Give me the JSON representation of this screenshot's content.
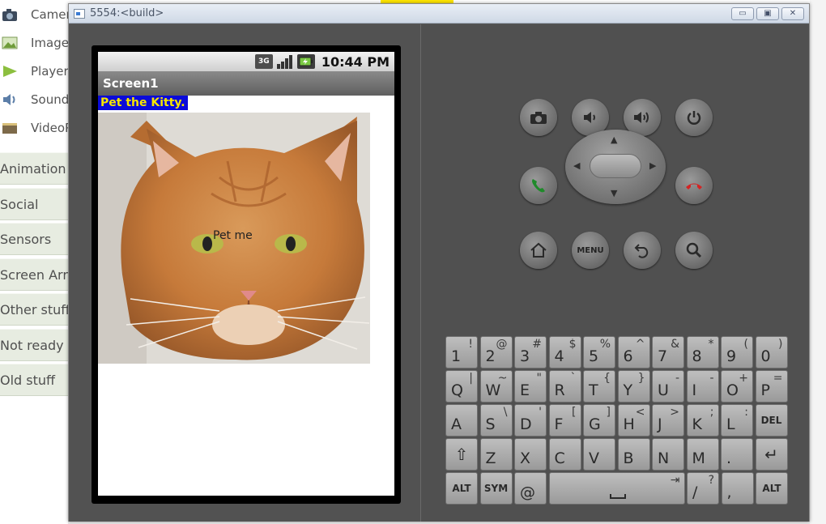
{
  "palette": {
    "items": [
      {
        "label": "Camera",
        "icon": "camera-icon"
      },
      {
        "label": "ImagePicker",
        "icon": "image-picker-icon"
      },
      {
        "label": "Player",
        "icon": "player-icon"
      },
      {
        "label": "Sound",
        "icon": "sound-icon"
      },
      {
        "label": "VideoPlayer",
        "icon": "video-icon"
      }
    ],
    "categories": [
      "Animation",
      "Social",
      "Sensors",
      "Screen Arrangement",
      "Other stuff",
      "Not ready for prime time",
      "Old stuff"
    ]
  },
  "window": {
    "title": "5554:<build>",
    "minimize": "▭",
    "maximize": "▣",
    "close": "✕"
  },
  "phone": {
    "status": {
      "network": "3G",
      "time": "10:44 PM"
    },
    "appbar_title": "Screen1",
    "label_text": "Pet the Kitty.",
    "button_text": "Pet me"
  },
  "controls": {
    "menu_label": "MENU"
  },
  "keyboard": {
    "rows": [
      [
        {
          "m": "1",
          "s": "!"
        },
        {
          "m": "2",
          "s": "@"
        },
        {
          "m": "3",
          "s": "#"
        },
        {
          "m": "4",
          "s": "$"
        },
        {
          "m": "5",
          "s": "%"
        },
        {
          "m": "6",
          "s": "^"
        },
        {
          "m": "7",
          "s": "&"
        },
        {
          "m": "8",
          "s": "*"
        },
        {
          "m": "9",
          "s": "("
        },
        {
          "m": "0",
          "s": ")"
        }
      ],
      [
        {
          "m": "Q",
          "s": "|"
        },
        {
          "m": "W",
          "s": "~"
        },
        {
          "m": "E",
          "s": "\""
        },
        {
          "m": "R",
          "s": "`"
        },
        {
          "m": "T",
          "s": "{"
        },
        {
          "m": "Y",
          "s": "}"
        },
        {
          "m": "U",
          "s": "-"
        },
        {
          "m": "I",
          "s": "-"
        },
        {
          "m": "O",
          "s": "+"
        },
        {
          "m": "P",
          "s": "="
        }
      ],
      [
        {
          "m": "A",
          "s": ""
        },
        {
          "m": "S",
          "s": "\\"
        },
        {
          "m": "D",
          "s": "'"
        },
        {
          "m": "F",
          "s": "["
        },
        {
          "m": "G",
          "s": "]"
        },
        {
          "m": "H",
          "s": "<"
        },
        {
          "m": "J",
          "s": ">"
        },
        {
          "m": "K",
          "s": ";"
        },
        {
          "m": "L",
          "s": ":"
        },
        {
          "m": "DEL",
          "s": ""
        }
      ],
      [
        {
          "m": "⇧",
          "s": ""
        },
        {
          "m": "Z",
          "s": ""
        },
        {
          "m": "X",
          "s": ""
        },
        {
          "m": "C",
          "s": ""
        },
        {
          "m": "V",
          "s": ""
        },
        {
          "m": "B",
          "s": ""
        },
        {
          "m": "N",
          "s": ""
        },
        {
          "m": "M",
          "s": ""
        },
        {
          "m": ".",
          "s": ""
        },
        {
          "m": "↵",
          "s": ""
        }
      ],
      [
        {
          "m": "ALT",
          "s": ""
        },
        {
          "m": "SYM",
          "s": ""
        },
        {
          "m": "@",
          "s": ""
        },
        {
          "m": "",
          "s": "⇥"
        },
        {
          "m": "/",
          "s": "?"
        },
        {
          "m": ",",
          "s": ""
        },
        {
          "m": "ALT",
          "s": ""
        }
      ]
    ]
  }
}
